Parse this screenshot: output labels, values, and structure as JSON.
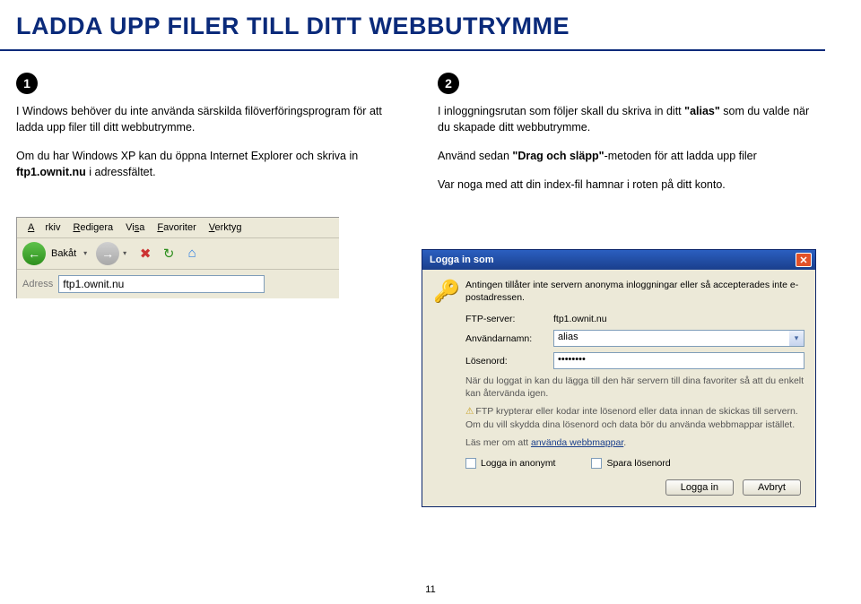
{
  "title": "LADDA UPP FILER TILL DITT WEBBUTRYMME",
  "page_number": "11",
  "step1": {
    "badge": "1",
    "p1": "I Windows behöver du inte använda särskilda filöverföringsprogram för att ladda upp filer till ditt webbutrymme.",
    "p2a": "Om du har Windows XP kan du öppna Internet Explorer och skriva in ",
    "p2b_bold": "ftp1.ownit.nu",
    "p2c": " i adressfältet."
  },
  "step2": {
    "badge": "2",
    "p1a": "I inloggningsrutan som följer skall du skriva in ditt ",
    "p1b_bold": "\"alias\"",
    "p1c": " som du valde när du skapade ditt webbutrymme.",
    "p2a": "Använd sedan ",
    "p2b_bold": "\"Drag och släpp\"",
    "p2c": "-metoden för att ladda upp filer",
    "p3": "Var noga med att din index-fil hamnar i roten på ditt konto."
  },
  "toolbar": {
    "menu": {
      "arkiv": "Arkiv",
      "redigera": "Redigera",
      "visa": "Visa",
      "favoriter": "Favoriter",
      "verktyg": "Verktyg"
    },
    "back_label": "Bakåt",
    "address_label": "Adress",
    "address_value": "ftp1.ownit.nu"
  },
  "dialog": {
    "title": "Logga in som",
    "intro": "Antingen tillåter inte servern anonyma inloggningar eller så accepterades inte e-postadressen.",
    "labels": {
      "server": "FTP-server:",
      "user": "Användarnamn:",
      "pass": "Lösenord:"
    },
    "values": {
      "server": "ftp1.ownit.nu",
      "user": "alias",
      "pass": "••••••••"
    },
    "info1": "När du loggat in kan du lägga till den här servern till dina favoriter så att du enkelt kan återvända igen.",
    "info2": "FTP krypterar eller kodar inte lösenord eller data innan de skickas till servern. Om du vill skydda dina lösenord och data bör du använda webbmappar istället.",
    "link_prefix": "Läs mer om att ",
    "link_text": "använda webbmappar",
    "link_suffix": ".",
    "check_anon": "Logga in anonymt",
    "check_save": "Spara lösenord",
    "btn_login": "Logga in",
    "btn_cancel": "Avbryt"
  }
}
